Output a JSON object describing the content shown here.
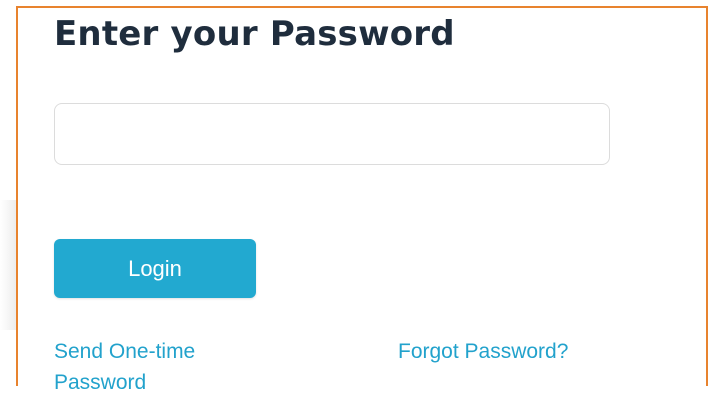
{
  "page": {
    "title": "Enter your Password"
  },
  "form": {
    "password_value": "",
    "password_placeholder": "",
    "login_label": "Login"
  },
  "links": {
    "otp_line1": "Send One-time",
    "otp_line2": "Password",
    "forgot_label": "Forgot Password?"
  },
  "colors": {
    "frame_border": "#e8832e",
    "button_bg": "#22a9d0",
    "link": "#22a2cc",
    "title": "#1f2d3d"
  }
}
